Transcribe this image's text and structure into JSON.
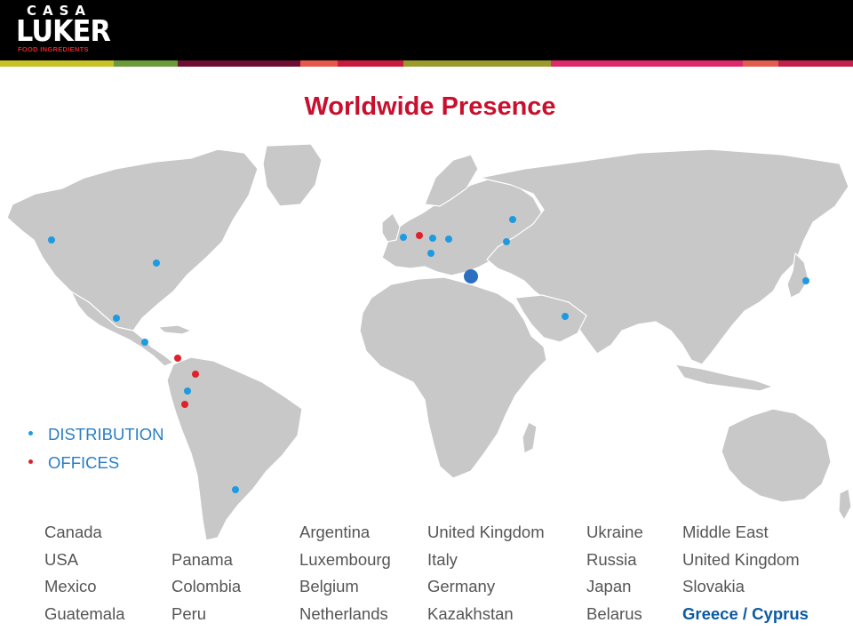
{
  "brand": {
    "casa": "CASA",
    "luker": "LUKER",
    "subtitle": "FOOD INGREDIENTS",
    "subtitle_color": "#e3242b"
  },
  "stripe_colors": [
    "#c7c225",
    "#6b9a3a",
    "#6e1033",
    "#e5584b",
    "#c91b3e",
    "#9c9a2a",
    "#de2a6a",
    "#e25c4f",
    "#c2204a"
  ],
  "title": "Worldwide Presence",
  "title_color": "#c8102e",
  "map_colors": {
    "land": "#c8c8c8",
    "border": "#ffffff",
    "distribution": "#1e9be0",
    "office": "#e0202a",
    "hq": "#2b6fc2"
  },
  "legend": [
    {
      "label": "DISTRIBUTION",
      "kind": "distribution",
      "color": "#1e9be0"
    },
    {
      "label": "OFFICES",
      "kind": "office",
      "color": "#e0202a"
    }
  ],
  "countries": [
    [
      "Canada",
      "USA",
      "Mexico",
      "Guatemala"
    ],
    [
      "",
      "Panama",
      "Colombia",
      "Peru"
    ],
    [
      "Argentina",
      "Luxembourg",
      "Belgium",
      "Netherlands"
    ],
    [
      "United Kingdom",
      "Italy",
      "Germany",
      "Kazakhstan"
    ],
    [
      "Ukraine",
      "Russia",
      "Japan",
      "Belarus"
    ],
    [
      "Middle East",
      "United Kingdom",
      "Slovakia",
      "Greece / Cyprus"
    ]
  ],
  "highlighted_country": "Greece / Cyprus"
}
